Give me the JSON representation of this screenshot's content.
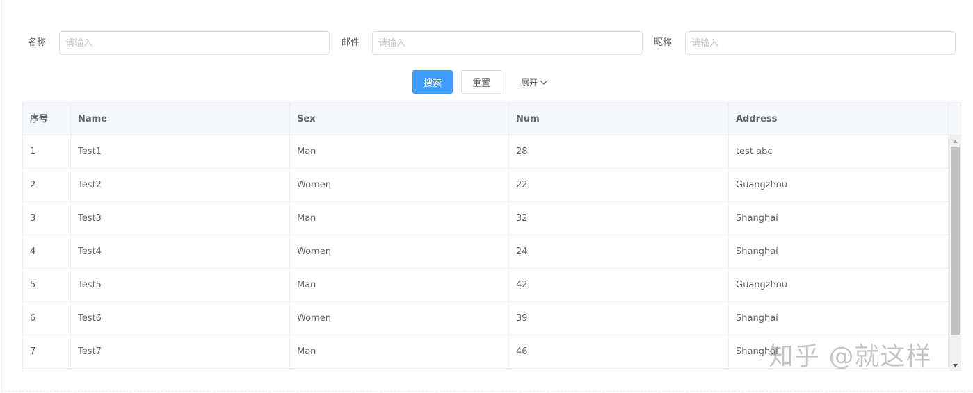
{
  "form": {
    "fields": [
      {
        "label": "名称",
        "placeholder": "请输入",
        "value": ""
      },
      {
        "label": "邮件",
        "placeholder": "请输入",
        "value": ""
      },
      {
        "label": "昵称",
        "placeholder": "请输入",
        "value": ""
      }
    ],
    "search_label": "搜索",
    "reset_label": "重置",
    "expand_label": "展开",
    "primary_color": "#409eff"
  },
  "table": {
    "columns": [
      "序号",
      "Name",
      "Sex",
      "Num",
      "Address"
    ],
    "rows": [
      [
        "1",
        "Test1",
        "Man",
        "28",
        "test abc"
      ],
      [
        "2",
        "Test2",
        "Women",
        "22",
        "Guangzhou"
      ],
      [
        "3",
        "Test3",
        "Man",
        "32",
        "Shanghai"
      ],
      [
        "4",
        "Test4",
        "Women",
        "24",
        "Shanghai"
      ],
      [
        "5",
        "Test5",
        "Man",
        "42",
        "Guangzhou"
      ],
      [
        "6",
        "Test6",
        "Women",
        "39",
        "Shanghai"
      ],
      [
        "7",
        "Test7",
        "Man",
        "46",
        "Shanghai"
      ]
    ]
  },
  "watermark": "知乎 @就这样"
}
